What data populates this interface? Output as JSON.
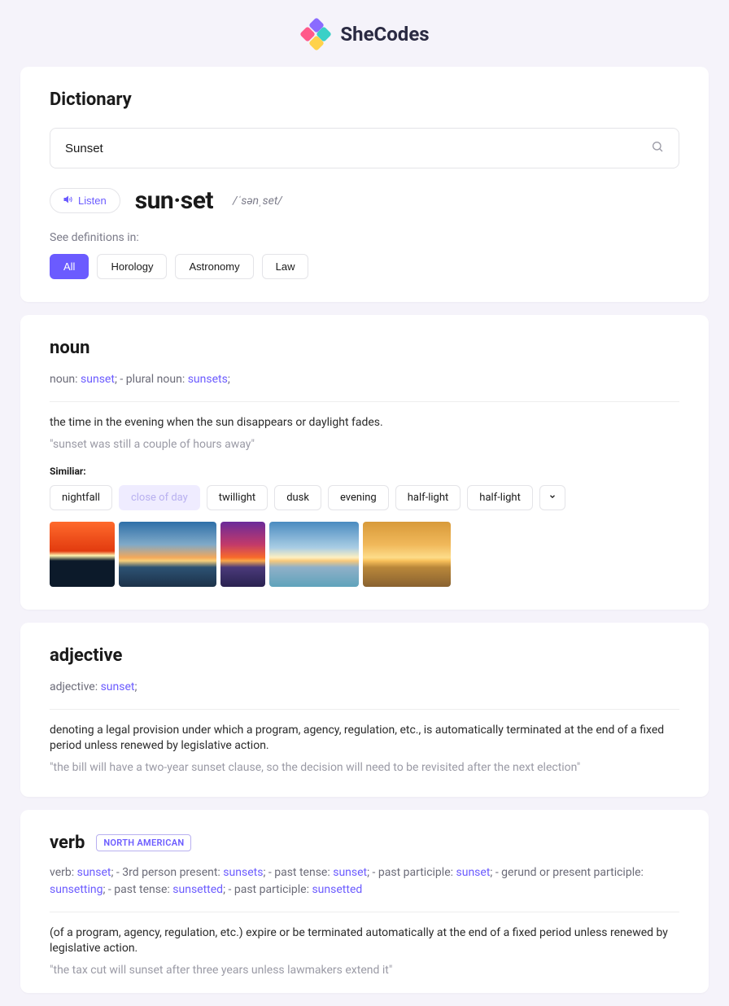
{
  "brand": "SheCodes",
  "header": {
    "title": "Dictionary",
    "search_value": "Sunset",
    "listen_label": "Listen",
    "word_display": "sun·set",
    "phonetic": "/ˈsənˌset/",
    "see_definitions_label": "See definitions in:",
    "categories": [
      "All",
      "Horology",
      "Astronomy",
      "Law"
    ],
    "active_category": "All"
  },
  "noun": {
    "pos": "noun",
    "forms_parts": [
      {
        "t": "noun: "
      },
      {
        "t": "sunset",
        "hi": true
      },
      {
        "t": ";   -   plural noun: "
      },
      {
        "t": "sunsets",
        "hi": true
      },
      {
        "t": ";"
      }
    ],
    "definition": "the time in the evening when the sun disappears or daylight fades.",
    "example": "\"sunset was still a couple of hours away\"",
    "similar_label": "Similiar:",
    "similar": [
      {
        "label": "nightfall"
      },
      {
        "label": "close of day",
        "muted": true
      },
      {
        "label": "twillight"
      },
      {
        "label": "dusk"
      },
      {
        "label": "evening"
      },
      {
        "label": "half-light"
      },
      {
        "label": "half-light"
      }
    ]
  },
  "adjective": {
    "pos": "adjective",
    "forms_parts": [
      {
        "t": "adjective: "
      },
      {
        "t": "sunset",
        "hi": true
      },
      {
        "t": ";"
      }
    ],
    "definition": "denoting a legal provision under which a program, agency, regulation, etc., is automatically terminated at the end of a fixed period unless renewed by legislative action.",
    "example": "\"the bill will have a two-year sunset clause, so the decision will need to be revisited after the next election\""
  },
  "verb": {
    "pos": "verb",
    "region": "NORTH AMERICAN",
    "forms_parts": [
      {
        "t": "verb: "
      },
      {
        "t": "sunset",
        "hi": true
      },
      {
        "t": ";   -   3rd person present: "
      },
      {
        "t": "sunsets",
        "hi": true
      },
      {
        "t": ";   -   past tense: "
      },
      {
        "t": "sunset",
        "hi": true
      },
      {
        "t": ";   -   past participle: "
      },
      {
        "t": "sunset",
        "hi": true
      },
      {
        "t": ";   -   gerund or present participle: "
      },
      {
        "t": "sunsetting",
        "hi": true
      },
      {
        "t": ";   -   past tense: "
      },
      {
        "t": "sunsetted",
        "hi": true
      },
      {
        "t": ";   -   past participle: "
      },
      {
        "t": "sunsetted",
        "hi": true
      }
    ],
    "definition": "(of a program, agency, regulation, etc.) expire or be terminated automatically at the end of a fixed period unless renewed by legislative action.",
    "example": "\"the tax cut will sunset after three years unless lawmakers extend it\""
  }
}
